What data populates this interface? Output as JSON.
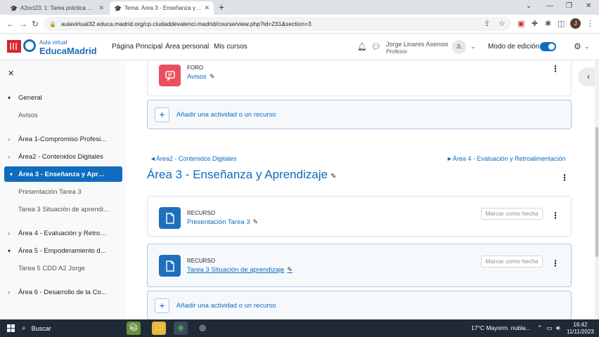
{
  "browser": {
    "tabs": [
      {
        "title": "A2oct23: 1: Tarea práctica 5 - Nu",
        "active": false
      },
      {
        "title": "Tema: Área 3 - Enseñanza y Apre",
        "active": true
      }
    ],
    "url": "aulavirtual32.educa.madrid.org/cp.ciudaddevalenci.madrid/course/view.php?id=231&section=3",
    "profile_initial": "J"
  },
  "navbar": {
    "logo_top": "Aula virtual",
    "logo_main": "EducaMadrid",
    "links": [
      "Página Principal",
      "Área personal",
      "Mis cursos"
    ],
    "user_name": "Jorge Linares Asensio",
    "user_role": "Profesor",
    "avatar_initials": "JL",
    "edit_mode_label": "Modo de edición",
    "edit_mode_on": true
  },
  "sidebar": {
    "items": [
      {
        "label": "General",
        "caret": "▾",
        "type": "section"
      },
      {
        "label": "Avisos",
        "type": "sub"
      },
      {
        "label": "Área 1-Compromiso Profesi...",
        "caret": "›",
        "type": "section"
      },
      {
        "label": "Área2 - Contenidos Digitales",
        "caret": "›",
        "type": "section"
      },
      {
        "label": "Área 3 - Enseñanza y Aprend...",
        "caret": "▾",
        "type": "section",
        "active": true
      },
      {
        "label": "Presentación Tarea 3",
        "type": "sub"
      },
      {
        "label": "Tarea 3 Situación de aprendi...",
        "type": "sub"
      },
      {
        "label": "Área 4 - Evaluación y Retroal...",
        "caret": "›",
        "type": "section"
      },
      {
        "label": "Área 5 - Empoderamiento d...",
        "caret": "▾",
        "type": "section"
      },
      {
        "label": "Tarea 5 CDD A2 Jorge",
        "type": "sub"
      },
      {
        "label": "Área 6 - Desarrollo de la Co...",
        "caret": "›",
        "type": "section"
      }
    ]
  },
  "main": {
    "forum": {
      "type": "FORO",
      "name": "Avisos"
    },
    "add_activity_label": "Añadir una actividad o un recurso",
    "prev_section": "◄Área2 - Contenidos Digitales",
    "next_section": "►Área 4 - Evaluación y Retroalimentación",
    "section_title": "Área 3 - Enseñanza y Aprendizaje",
    "resources": [
      {
        "type": "RECURSO",
        "name": "Presentación Tarea 3",
        "done_label": "Marcar como hecha"
      },
      {
        "type": "RECURSO",
        "name": "Tarea 3 Situación de aprendizaje",
        "done_label": "Marcar como hecha"
      }
    ]
  },
  "taskbar": {
    "search_label": "Buscar",
    "weather": "17°C  Mayorm. nubla...",
    "time": "16:42",
    "date": "11/11/2023"
  },
  "colors": {
    "accent": "#0f6cbf",
    "forum_icon": "#e9505f",
    "resource_icon": "#1f6fbf",
    "taskbar": "#1f2a36"
  }
}
